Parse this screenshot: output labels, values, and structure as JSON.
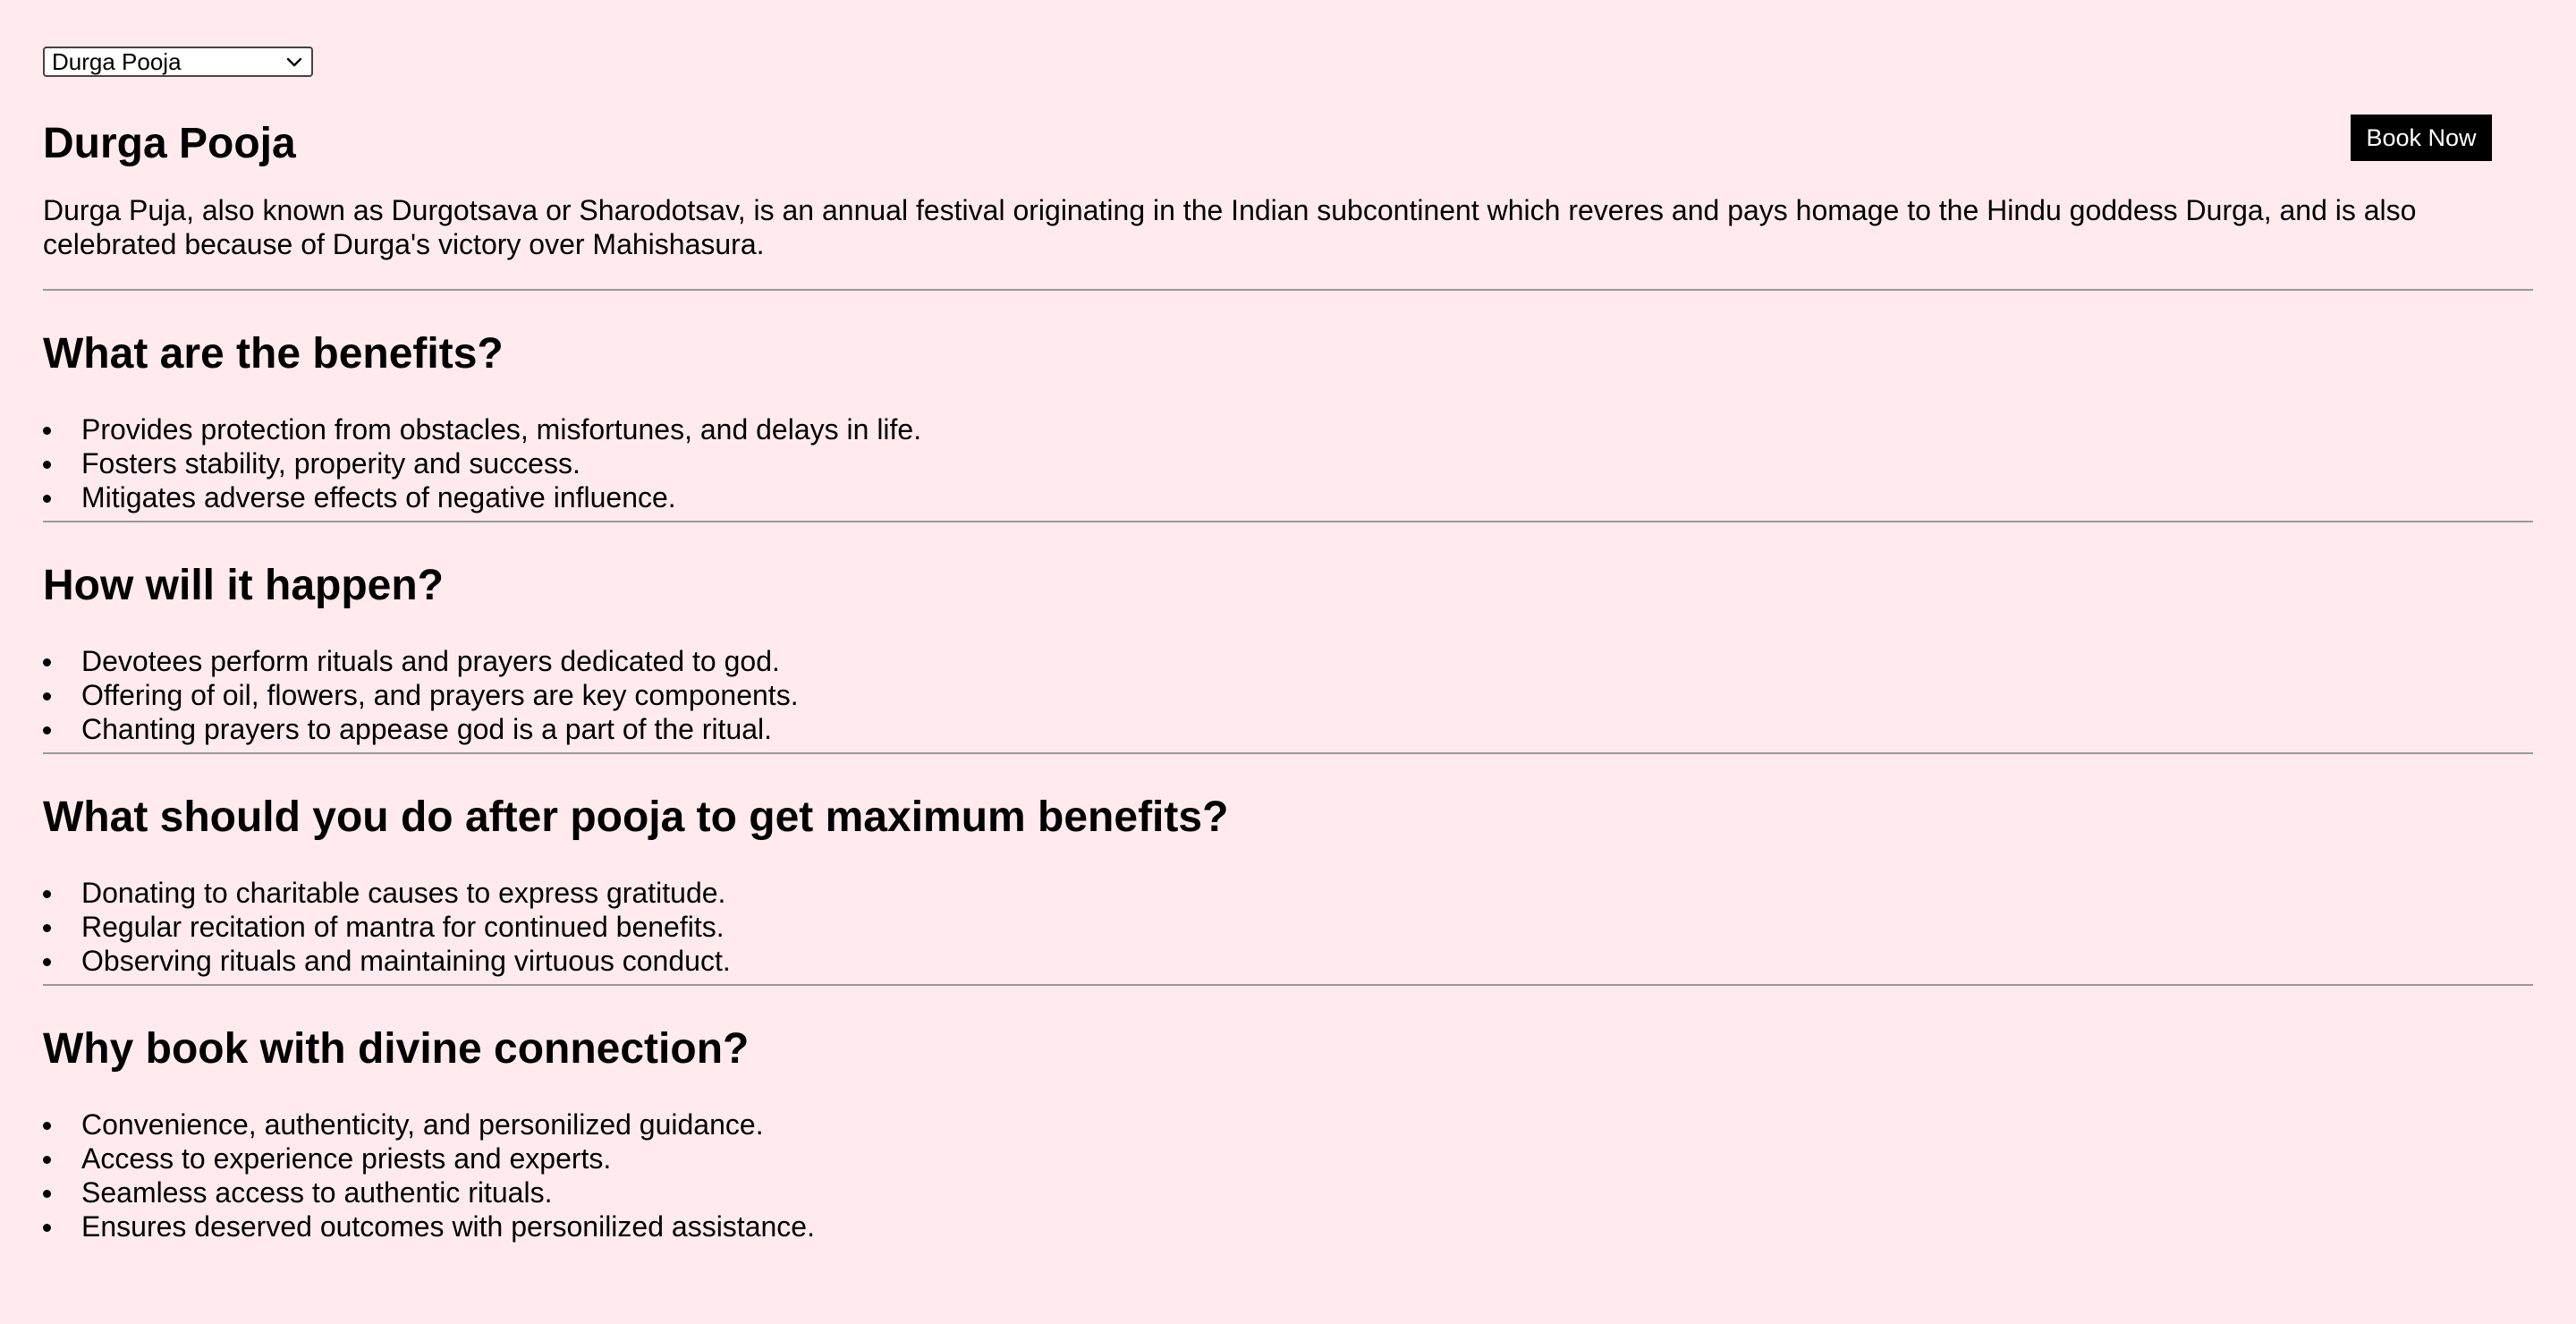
{
  "dropdown": {
    "selected": "Durga Pooja"
  },
  "header": {
    "title": "Durga Pooja",
    "book_label": "Book Now"
  },
  "intro": "Durga Puja, also known as Durgotsava or Sharodotsav, is an annual festival originating in the Indian subcontinent which reveres and pays homage to the Hindu goddess Durga, and is also celebrated because of Durga's victory over Mahishasura.",
  "sections": [
    {
      "heading": "What are the benefits?",
      "items": [
        "Provides protection from obstacles, misfortunes, and delays in life.",
        "Fosters stability, properity and success.",
        "Mitigates adverse effects of negative influence."
      ]
    },
    {
      "heading": "How will it happen?",
      "items": [
        "Devotees perform rituals and prayers dedicated to god.",
        "Offering of oil, flowers, and prayers are key components.",
        "Chanting prayers to appease god is a part of the ritual."
      ]
    },
    {
      "heading": "What should you do after pooja to get maximum benefits?",
      "items": [
        "Donating to charitable causes to express gratitude.",
        "Regular recitation of mantra for continued benefits.",
        "Observing rituals and maintaining virtuous conduct."
      ]
    },
    {
      "heading": "Why book with divine connection?",
      "items": [
        "Convenience, authenticity, and personilized guidance.",
        "Access to experience priests and experts.",
        "Seamless access to authentic rituals.",
        "Ensures deserved outcomes with personilized assistance."
      ]
    }
  ],
  "icons": {
    "dropdown": "chevron-down-icon"
  },
  "colors": {
    "background": "#ffebed",
    "button": "#000000",
    "button_text": "#ffffff",
    "divider": "#999999"
  }
}
